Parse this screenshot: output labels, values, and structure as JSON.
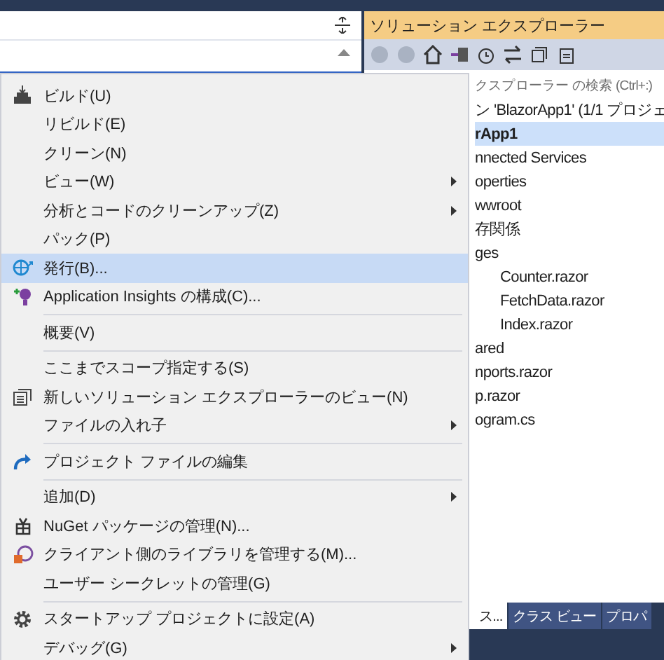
{
  "solution_explorer": {
    "title": "ソリューション エクスプローラー",
    "search": {
      "placeholder": "クスプローラー の検索 (Ctrl+:)"
    },
    "tree": [
      {
        "label": "ン 'BlazorApp1' (1/1 プロジェ",
        "selected": false,
        "bold": false
      },
      {
        "label": "rApp1",
        "selected": true,
        "bold": true
      },
      {
        "label": "nnected Services",
        "selected": false,
        "bold": false
      },
      {
        "label": "operties",
        "selected": false,
        "bold": false
      },
      {
        "label": "wwroot",
        "selected": false,
        "bold": false
      },
      {
        "label": "存関係",
        "selected": false,
        "bold": false
      },
      {
        "label": "ges",
        "selected": false,
        "bold": false,
        "children": [
          {
            "label": "Counter.razor",
            "selected": false,
            "bold": false
          },
          {
            "label": "FetchData.razor",
            "selected": false,
            "bold": false
          },
          {
            "label": "Index.razor",
            "selected": false,
            "bold": false
          }
        ]
      },
      {
        "label": "ared",
        "selected": false,
        "bold": false
      },
      {
        "label": "nports.razor",
        "selected": false,
        "bold": false
      },
      {
        "label": "p.razor",
        "selected": false,
        "bold": false
      },
      {
        "label": "ogram.cs",
        "selected": false,
        "bold": false
      }
    ],
    "tabs": [
      {
        "label": "ス...",
        "selected": true
      },
      {
        "label": "クラス ビュー",
        "selected": false
      },
      {
        "label": "プロパ",
        "selected": false
      }
    ]
  },
  "context_menu": {
    "items": [
      {
        "label": "ビルド(U)",
        "kind": "build",
        "submenu": false,
        "selected": false,
        "separator_before": false
      },
      {
        "label": "リビルド(E)",
        "submenu": false,
        "selected": false,
        "separator_before": false
      },
      {
        "label": "クリーン(N)",
        "submenu": false,
        "selected": false,
        "separator_before": false
      },
      {
        "label": "ビュー(W)",
        "submenu": true,
        "selected": false,
        "separator_before": false
      },
      {
        "label": "分析とコードのクリーンアップ(Z)",
        "submenu": true,
        "selected": false,
        "separator_before": false
      },
      {
        "label": "パック(P)",
        "submenu": false,
        "selected": false,
        "separator_before": false
      },
      {
        "label": "発行(B)...",
        "kind": "publish",
        "submenu": false,
        "selected": true,
        "separator_before": false
      },
      {
        "label": "Application Insights の構成(C)...",
        "kind": "insights",
        "submenu": false,
        "selected": false,
        "separator_before": false
      },
      {
        "label": "概要(V)",
        "submenu": false,
        "selected": false,
        "separator_before": true
      },
      {
        "label": "ここまでスコープ指定する(S)",
        "submenu": false,
        "selected": false,
        "separator_before": true
      },
      {
        "label": "新しいソリューション エクスプローラーのビュー(N)",
        "kind": "newview",
        "submenu": false,
        "selected": false,
        "separator_before": false
      },
      {
        "label": "ファイルの入れ子",
        "submenu": true,
        "selected": false,
        "separator_before": false
      },
      {
        "label": "プロジェクト ファイルの編集",
        "kind": "edit",
        "submenu": false,
        "selected": false,
        "separator_before": true
      },
      {
        "label": "追加(D)",
        "submenu": true,
        "selected": false,
        "separator_before": true
      },
      {
        "label": "NuGet パッケージの管理(N)...",
        "kind": "nuget",
        "submenu": false,
        "selected": false,
        "separator_before": false
      },
      {
        "label": "クライアント側のライブラリを管理する(M)...",
        "kind": "library",
        "submenu": false,
        "selected": false,
        "separator_before": false
      },
      {
        "label": "ユーザー シークレットの管理(G)",
        "submenu": false,
        "selected": false,
        "separator_before": false
      },
      {
        "label": "スタートアップ プロジェクトに設定(A)",
        "kind": "gear",
        "submenu": false,
        "selected": false,
        "separator_before": true
      },
      {
        "label": "デバッグ(G)",
        "submenu": true,
        "selected": false,
        "separator_before": false
      }
    ]
  }
}
